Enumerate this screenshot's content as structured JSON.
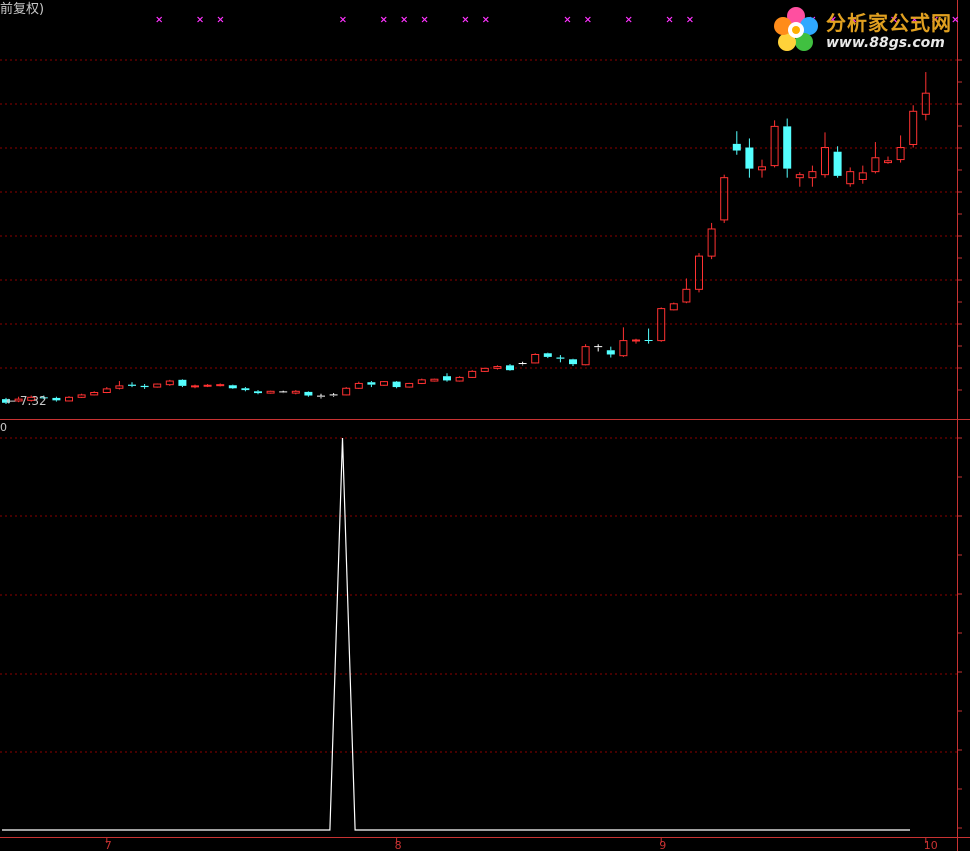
{
  "header": {
    "title": "前复权)"
  },
  "logo": {
    "name": "分析家公式网",
    "url": "www.88gs.com"
  },
  "colors": {
    "up": "#ff3232",
    "down": "#54ffff",
    "flat": "#ffffff",
    "signal": "#ff33ff",
    "grid": "#8b0000",
    "axis": "#c83232",
    "indicator": "#ffffff"
  },
  "chart_data": [
    {
      "type": "candlestick",
      "title": "",
      "price_label": "← 7.32",
      "value_scale_note": "y values in relative price units (unscaled axis, no tick labels shown)",
      "ylim": [
        7.2,
        13.0
      ],
      "grid": true,
      "candles": [
        {
          "o": 7.32,
          "h": 7.4,
          "l": 7.3,
          "c": 7.38,
          "col": "down"
        },
        {
          "o": 7.38,
          "h": 7.42,
          "l": 7.33,
          "c": 7.35,
          "col": "up"
        },
        {
          "o": 7.36,
          "h": 7.44,
          "l": 7.34,
          "c": 7.41,
          "col": "up"
        },
        {
          "o": 7.41,
          "h": 7.44,
          "l": 7.38,
          "c": 7.4,
          "col": "down"
        },
        {
          "o": 7.4,
          "h": 7.42,
          "l": 7.34,
          "c": 7.36,
          "col": "down"
        },
        {
          "o": 7.35,
          "h": 7.43,
          "l": 7.34,
          "c": 7.41,
          "col": "up"
        },
        {
          "o": 7.41,
          "h": 7.47,
          "l": 7.4,
          "c": 7.45,
          "col": "up"
        },
        {
          "o": 7.45,
          "h": 7.51,
          "l": 7.44,
          "c": 7.49,
          "col": "up"
        },
        {
          "o": 7.49,
          "h": 7.58,
          "l": 7.48,
          "c": 7.55,
          "col": "up"
        },
        {
          "o": 7.56,
          "h": 7.68,
          "l": 7.54,
          "c": 7.6,
          "col": "up"
        },
        {
          "o": 7.62,
          "h": 7.66,
          "l": 7.58,
          "c": 7.6,
          "col": "down"
        },
        {
          "o": 7.6,
          "h": 7.63,
          "l": 7.55,
          "c": 7.58,
          "col": "down"
        },
        {
          "o": 7.58,
          "h": 7.64,
          "l": 7.57,
          "c": 7.63,
          "col": "up"
        },
        {
          "o": 7.62,
          "h": 7.7,
          "l": 7.6,
          "c": 7.68,
          "col": "up"
        },
        {
          "o": 7.7,
          "h": 7.71,
          "l": 7.58,
          "c": 7.6,
          "col": "down"
        },
        {
          "o": 7.59,
          "h": 7.62,
          "l": 7.56,
          "c": 7.6,
          "col": "up"
        },
        {
          "o": 7.6,
          "h": 7.63,
          "l": 7.58,
          "c": 7.61,
          "col": "up"
        },
        {
          "o": 7.61,
          "h": 7.64,
          "l": 7.59,
          "c": 7.62,
          "col": "up"
        },
        {
          "o": 7.61,
          "h": 7.62,
          "l": 7.55,
          "c": 7.56,
          "col": "down"
        },
        {
          "o": 7.56,
          "h": 7.58,
          "l": 7.51,
          "c": 7.53,
          "col": "down"
        },
        {
          "o": 7.51,
          "h": 7.53,
          "l": 7.46,
          "c": 7.48,
          "col": "down"
        },
        {
          "o": 7.48,
          "h": 7.52,
          "l": 7.47,
          "c": 7.51,
          "col": "up"
        },
        {
          "o": 7.5,
          "h": 7.52,
          "l": 7.48,
          "c": 7.5,
          "col": "flat"
        },
        {
          "o": 7.48,
          "h": 7.53,
          "l": 7.46,
          "c": 7.51,
          "col": "up"
        },
        {
          "o": 7.5,
          "h": 7.51,
          "l": 7.42,
          "c": 7.44,
          "col": "down"
        },
        {
          "o": 7.43,
          "h": 7.47,
          "l": 7.39,
          "c": 7.43,
          "col": "flat"
        },
        {
          "o": 7.44,
          "h": 7.48,
          "l": 7.42,
          "c": 7.45,
          "col": "flat"
        },
        {
          "o": 7.45,
          "h": 7.58,
          "l": 7.44,
          "c": 7.56,
          "col": "up"
        },
        {
          "o": 7.56,
          "h": 7.67,
          "l": 7.55,
          "c": 7.64,
          "col": "up"
        },
        {
          "o": 7.66,
          "h": 7.68,
          "l": 7.58,
          "c": 7.62,
          "col": "down"
        },
        {
          "o": 7.61,
          "h": 7.68,
          "l": 7.6,
          "c": 7.67,
          "col": "up"
        },
        {
          "o": 7.67,
          "h": 7.68,
          "l": 7.56,
          "c": 7.58,
          "col": "down"
        },
        {
          "o": 7.58,
          "h": 7.65,
          "l": 7.57,
          "c": 7.64,
          "col": "up"
        },
        {
          "o": 7.64,
          "h": 7.72,
          "l": 7.63,
          "c": 7.7,
          "col": "up"
        },
        {
          "o": 7.68,
          "h": 7.72,
          "l": 7.67,
          "c": 7.71,
          "col": "up"
        },
        {
          "o": 7.76,
          "h": 7.81,
          "l": 7.67,
          "c": 7.69,
          "col": "down"
        },
        {
          "o": 7.68,
          "h": 7.76,
          "l": 7.67,
          "c": 7.74,
          "col": "up"
        },
        {
          "o": 7.74,
          "h": 7.86,
          "l": 7.73,
          "c": 7.84,
          "col": "up"
        },
        {
          "o": 7.84,
          "h": 7.9,
          "l": 7.83,
          "c": 7.89,
          "col": "up"
        },
        {
          "o": 7.89,
          "h": 7.94,
          "l": 7.87,
          "c": 7.92,
          "col": "up"
        },
        {
          "o": 7.94,
          "h": 7.96,
          "l": 7.85,
          "c": 7.86,
          "col": "down"
        },
        {
          "o": 7.96,
          "h": 8.0,
          "l": 7.94,
          "c": 7.97,
          "col": "flat"
        },
        {
          "o": 7.98,
          "h": 8.14,
          "l": 7.97,
          "c": 8.12,
          "col": "up"
        },
        {
          "o": 8.14,
          "h": 8.15,
          "l": 8.06,
          "c": 8.08,
          "col": "down"
        },
        {
          "o": 8.07,
          "h": 8.11,
          "l": 7.99,
          "c": 8.05,
          "col": "down"
        },
        {
          "o": 8.04,
          "h": 8.05,
          "l": 7.93,
          "c": 7.96,
          "col": "down"
        },
        {
          "o": 7.95,
          "h": 8.29,
          "l": 7.94,
          "c": 8.25,
          "col": "up"
        },
        {
          "o": 8.25,
          "h": 8.29,
          "l": 8.17,
          "c": 8.24,
          "col": "flat"
        },
        {
          "o": 8.19,
          "h": 8.25,
          "l": 8.07,
          "c": 8.12,
          "col": "down"
        },
        {
          "o": 8.1,
          "h": 8.57,
          "l": 8.08,
          "c": 8.35,
          "col": "up"
        },
        {
          "o": 8.35,
          "h": 8.38,
          "l": 8.3,
          "c": 8.36,
          "col": "up"
        },
        {
          "o": 8.36,
          "h": 8.55,
          "l": 8.3,
          "c": 8.35,
          "col": "down"
        },
        {
          "o": 8.35,
          "h": 8.9,
          "l": 8.33,
          "c": 8.88,
          "col": "up"
        },
        {
          "o": 8.86,
          "h": 8.98,
          "l": 8.85,
          "c": 8.96,
          "col": "up"
        },
        {
          "o": 8.99,
          "h": 9.38,
          "l": 8.97,
          "c": 9.2,
          "col": "up"
        },
        {
          "o": 9.2,
          "h": 9.8,
          "l": 9.15,
          "c": 9.75,
          "col": "up"
        },
        {
          "o": 9.75,
          "h": 10.3,
          "l": 9.7,
          "c": 10.2,
          "col": "up"
        },
        {
          "o": 10.35,
          "h": 11.1,
          "l": 10.3,
          "c": 11.05,
          "col": "up"
        },
        {
          "o": 11.61,
          "h": 11.82,
          "l": 11.43,
          "c": 11.5,
          "col": "down"
        },
        {
          "o": 11.55,
          "h": 11.7,
          "l": 11.05,
          "c": 11.2,
          "col": "down"
        },
        {
          "o": 11.18,
          "h": 11.35,
          "l": 11.05,
          "c": 11.23,
          "col": "up"
        },
        {
          "o": 11.25,
          "h": 12.0,
          "l": 11.22,
          "c": 11.9,
          "col": "up"
        },
        {
          "o": 11.9,
          "h": 12.03,
          "l": 11.05,
          "c": 11.2,
          "col": "down"
        },
        {
          "o": 11.05,
          "h": 11.14,
          "l": 10.9,
          "c": 11.1,
          "col": "up"
        },
        {
          "o": 11.05,
          "h": 11.25,
          "l": 10.9,
          "c": 11.15,
          "col": "up"
        },
        {
          "o": 11.1,
          "h": 11.8,
          "l": 11.05,
          "c": 11.55,
          "col": "up"
        },
        {
          "o": 11.48,
          "h": 11.57,
          "l": 11.05,
          "c": 11.08,
          "col": "down"
        },
        {
          "o": 11.15,
          "h": 11.22,
          "l": 10.9,
          "c": 10.95,
          "col": "up"
        },
        {
          "o": 11.02,
          "h": 11.25,
          "l": 10.95,
          "c": 11.13,
          "col": "up"
        },
        {
          "o": 11.15,
          "h": 11.64,
          "l": 11.12,
          "c": 11.38,
          "col": "up"
        },
        {
          "o": 11.33,
          "h": 11.4,
          "l": 11.28,
          "c": 11.3,
          "col": "up"
        },
        {
          "o": 11.35,
          "h": 11.75,
          "l": 11.3,
          "c": 11.55,
          "col": "up"
        },
        {
          "o": 11.6,
          "h": 12.25,
          "l": 11.55,
          "c": 12.15,
          "col": "up"
        },
        {
          "o": 12.1,
          "h": 12.8,
          "l": 12.0,
          "c": 12.45,
          "col": "up"
        }
      ],
      "signals": [
        3,
        5,
        6,
        12,
        14,
        15,
        16,
        18,
        19,
        23,
        24,
        26,
        28,
        29,
        35,
        36,
        37,
        39,
        40,
        41,
        42,
        43,
        45,
        46
      ]
    },
    {
      "type": "line",
      "y_label_top": "0",
      "ylim": [
        0,
        1
      ],
      "series": [
        {
          "values": [
            0,
            0,
            0,
            0,
            0,
            0,
            0,
            0,
            0,
            0,
            0,
            0,
            0,
            0,
            0,
            0,
            0,
            0,
            0,
            0,
            0,
            0,
            0,
            0,
            0,
            0,
            0,
            1,
            0,
            0,
            0,
            0,
            0,
            0,
            0,
            0,
            0,
            0,
            0,
            0,
            0,
            0,
            0,
            0,
            0,
            0,
            0,
            0,
            0,
            0,
            0,
            0,
            0,
            0,
            0,
            0,
            0,
            0,
            0,
            0,
            0,
            0,
            0,
            0,
            0,
            0,
            0,
            0,
            0,
            0,
            0,
            0,
            0
          ]
        }
      ]
    }
  ],
  "x_axis": {
    "ticks": [
      {
        "label": "7",
        "index": 8
      },
      {
        "label": "8",
        "index": 31
      },
      {
        "label": "9",
        "index": 52
      },
      {
        "label": "10",
        "index": 73
      }
    ]
  }
}
